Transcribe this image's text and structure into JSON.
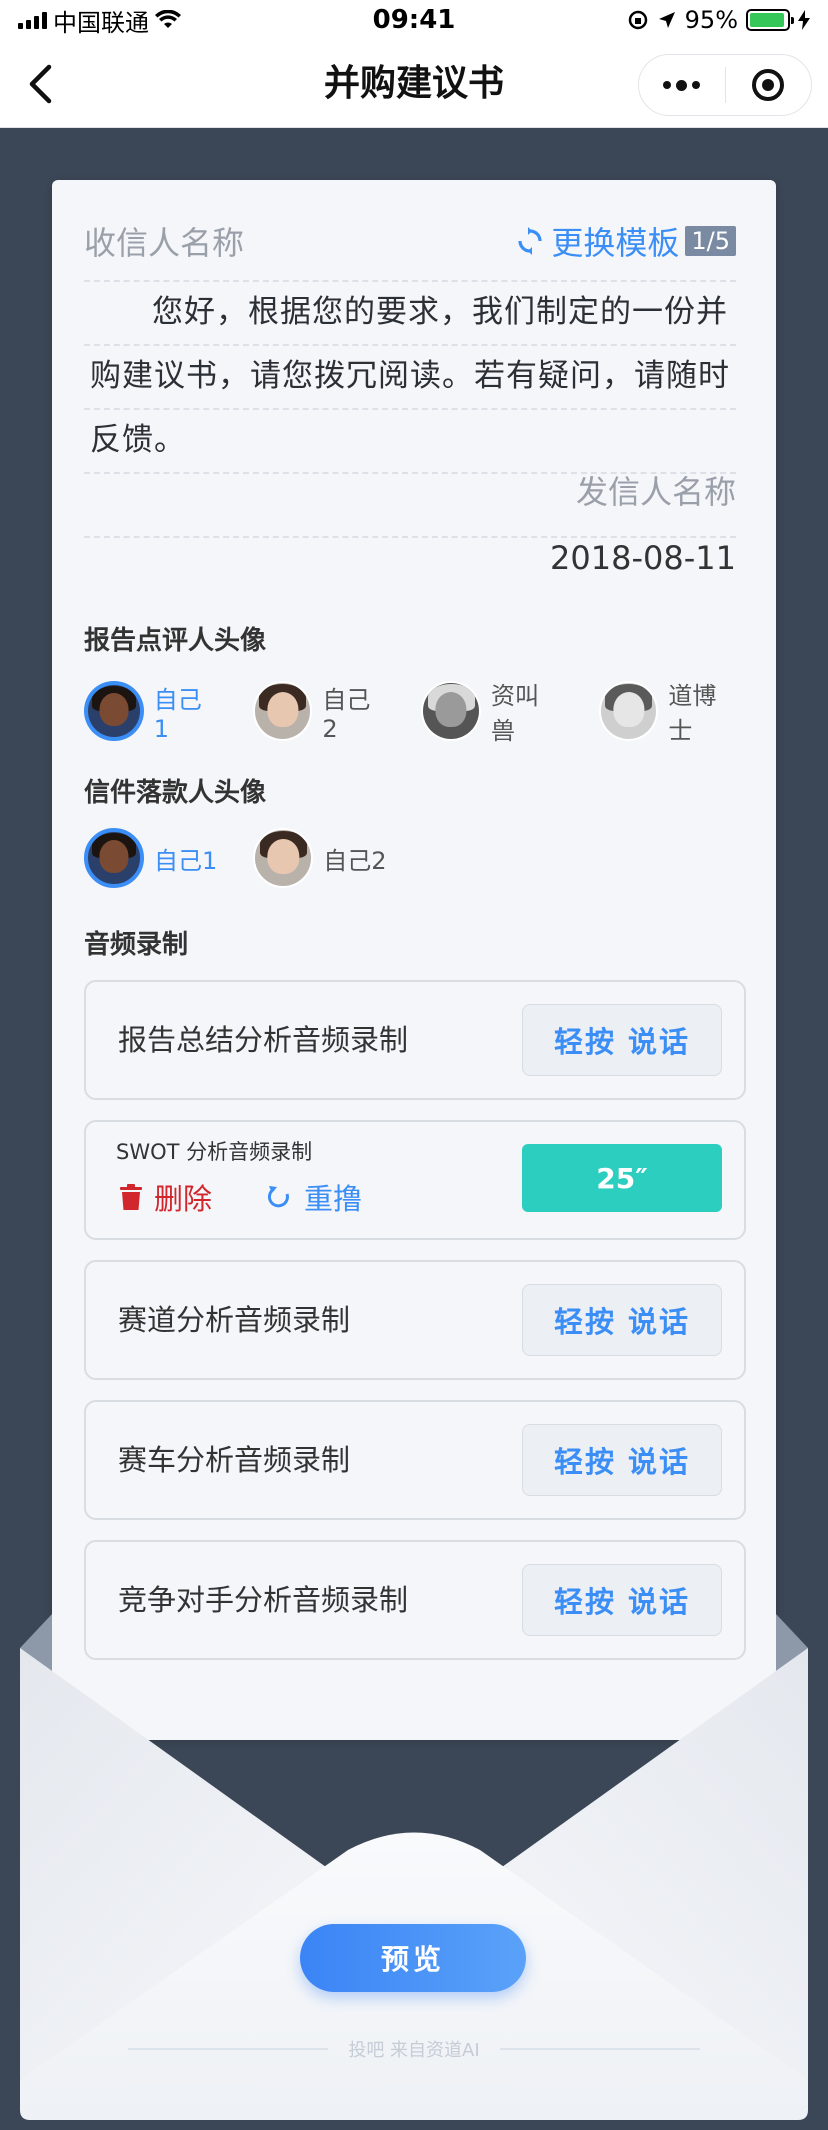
{
  "status_bar": {
    "carrier": "中国联通",
    "time": "09:41",
    "battery": "95%"
  },
  "nav": {
    "title": "并购建议书"
  },
  "letter": {
    "recipient_placeholder": "收信人名称",
    "template_label": "更换模板",
    "template_page": "1/5",
    "body": "您好，根据您的要求，我们制定的一份并购建议书，请您拨冗阅读。若有疑问，请随时反馈。",
    "sender_placeholder": "发信人名称",
    "date": "2018-08-11"
  },
  "reviewer": {
    "title": "报告点评人头像",
    "items": [
      {
        "label": "自己1",
        "selected": true
      },
      {
        "label": "自己2",
        "selected": false
      },
      {
        "label": "资叫兽",
        "selected": false
      },
      {
        "label": "道博士",
        "selected": false
      }
    ]
  },
  "signer": {
    "title": "信件落款人头像",
    "items": [
      {
        "label": "自己1",
        "selected": true
      },
      {
        "label": "自己2",
        "selected": false
      }
    ]
  },
  "audio": {
    "title": "音频录制",
    "talk_label": "轻按 说话",
    "items": [
      {
        "label": "报告总结分析音频录制"
      },
      {
        "label": "SWOT 分析音频录制",
        "recorded": true,
        "duration": "25″",
        "delete_label": "删除",
        "redo_label": "重撸"
      },
      {
        "label": "赛道分析音频录制"
      },
      {
        "label": "赛车分析音频录制"
      },
      {
        "label": "竞争对手分析音频录制"
      }
    ]
  },
  "footer": {
    "preview_label": "预览",
    "note": "投吧 来自资道AI"
  },
  "colors": {
    "accent": "#3a8ef6",
    "teal": "#2ccfbf",
    "danger": "#d0262c",
    "background": "#3b4656"
  }
}
